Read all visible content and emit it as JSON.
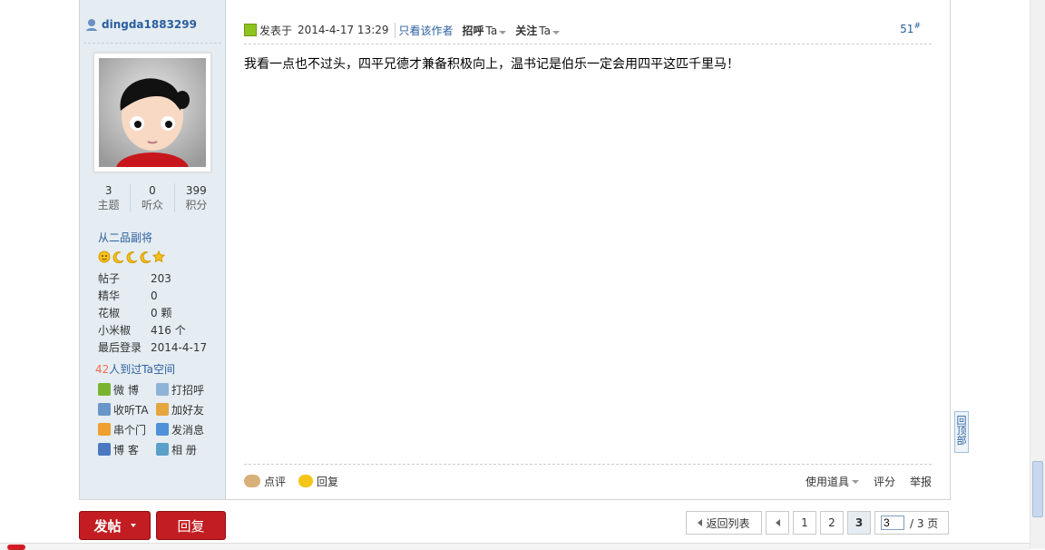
{
  "user": {
    "name": "dingda1883299",
    "stats": [
      {
        "num": "3",
        "label": "主题"
      },
      {
        "num": "0",
        "label": "听众"
      },
      {
        "num": "399",
        "label": "积分"
      }
    ],
    "rank": "从二品副将",
    "info": [
      {
        "key": "帖子",
        "value": "203"
      },
      {
        "key": "精华",
        "value": "0"
      },
      {
        "key": "花椒",
        "value": "0 颗"
      },
      {
        "key": "小米椒",
        "value": "416 个"
      },
      {
        "key": "最后登录",
        "value": "2014-4-17"
      }
    ],
    "visits_count": "42",
    "visits_text": "人到过Ta空间",
    "links": [
      {
        "label": "微 博",
        "icon": "weibo-icon",
        "color": "#79b42f"
      },
      {
        "label": "打招呼",
        "icon": "wave-icon",
        "color": "#8fb3d6"
      },
      {
        "label": "收听TA",
        "icon": "follow-icon",
        "color": "#6a95c8"
      },
      {
        "label": "加好友",
        "icon": "handshake-icon",
        "color": "#e5a640"
      },
      {
        "label": "串个门",
        "icon": "home-icon",
        "color": "#f0a030"
      },
      {
        "label": "发消息",
        "icon": "mail-icon",
        "color": "#4f90d9"
      },
      {
        "label": "博 客",
        "icon": "blog-icon",
        "color": "#4a79c0"
      },
      {
        "label": "相 册",
        "icon": "album-icon",
        "color": "#5aa0c8"
      }
    ]
  },
  "post": {
    "posted_prefix": "发表于",
    "time": "2014-4-17 13:29",
    "author_only": "只看该作者",
    "greet": "招呼",
    "follow": "关注",
    "ta": "Ta",
    "floor": "51",
    "floor_mark": "#",
    "content": "我看一点也不过头，四平兄德才兼备积极向上，温书记是伯乐一定会用四平这匹千里马！",
    "comment": "点评",
    "reply": "回复",
    "use_tool": "使用道具",
    "rate": "评分",
    "report": "举报"
  },
  "actions": {
    "new_post": "发帖",
    "reply": "回复"
  },
  "pager": {
    "back": "返回列表",
    "pages": [
      "1",
      "2",
      "3"
    ],
    "current": "3",
    "input_value": "3",
    "total": "/ 3 页"
  },
  "backtop": "回顶部",
  "colors": {
    "link_blue": "#2b5e9e",
    "sidebar_bg": "#e5edf2",
    "button_red": "#c21d22"
  }
}
